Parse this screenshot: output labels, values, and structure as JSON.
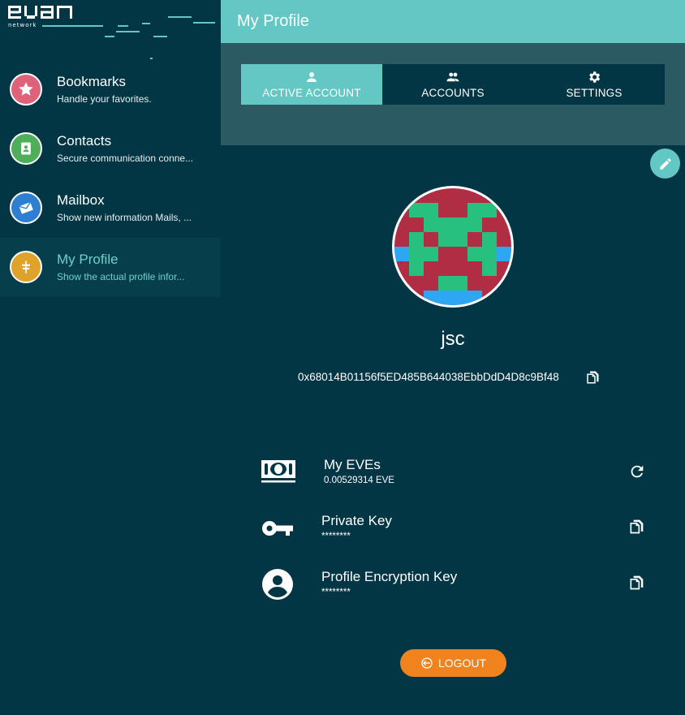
{
  "brand": {
    "logo_text": "evan",
    "sub_text": "network"
  },
  "sidebar": {
    "items": [
      {
        "title": "Bookmarks",
        "subtitle": "Handle your favorites.",
        "icon": "star-icon",
        "color": "#e0617a"
      },
      {
        "title": "Contacts",
        "subtitle": "Secure communication conne...",
        "icon": "contact-book-icon",
        "color": "#4fae5a"
      },
      {
        "title": "Mailbox",
        "subtitle": "Show new information Mails, ...",
        "icon": "mail-icon",
        "color": "#2e7ed1"
      },
      {
        "title": "My Profile",
        "subtitle": "Show the actual profile infor...",
        "icon": "profile-signpost-icon",
        "color": "#dfa22a"
      }
    ],
    "active_index": 3
  },
  "header": {
    "title": "My Profile"
  },
  "tabs": [
    {
      "label": "ACTIVE ACCOUNT",
      "icon": "person-icon",
      "active": true
    },
    {
      "label": "ACCOUNTS",
      "icon": "people-icon",
      "active": false
    },
    {
      "label": "SETTINGS",
      "icon": "gear-icon",
      "active": false
    }
  ],
  "profile": {
    "username": "jsc",
    "address": "0x68014B01156f5ED485B644038EbbDdD4D8c9Bf48"
  },
  "details": {
    "eves": {
      "label": "My EVEs",
      "value": "0.00529314 EVE"
    },
    "private_key": {
      "label": "Private Key",
      "value": "********"
    },
    "encryption_key": {
      "label": "Profile Encryption Key",
      "value": "********"
    }
  },
  "logout": {
    "label": "LOGOUT"
  },
  "colors": {
    "background": "#033644",
    "accent": "#63c7c3",
    "logout": "#f0831e",
    "identicon_bg": "#b02d44",
    "identicon_green": "#27c07f",
    "identicon_blue": "#2ea7f2"
  }
}
